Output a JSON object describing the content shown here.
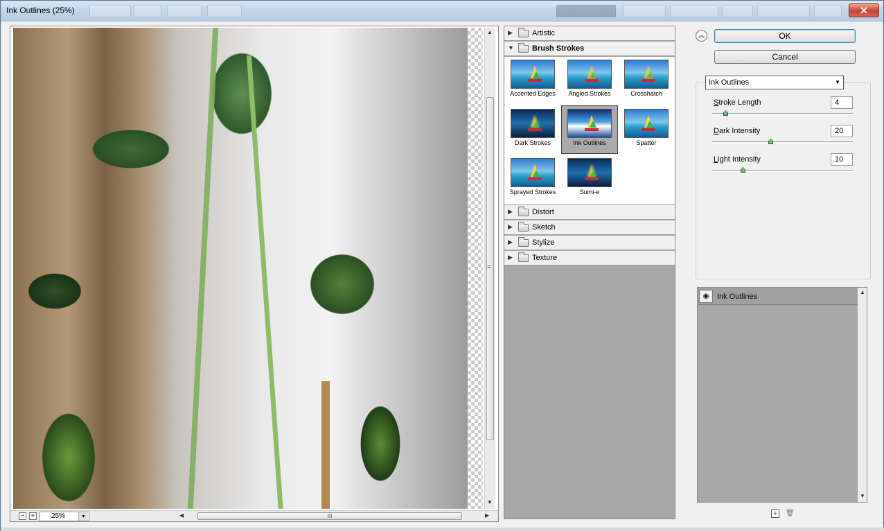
{
  "window": {
    "title": "Ink Outlines (25%)",
    "close_glyph": "✕"
  },
  "preview": {
    "zoom_value": "25%",
    "zoom_out": "−",
    "zoom_in": "+",
    "zoom_drop": "▾",
    "grip_h": "III",
    "grip_v": "≡",
    "arrow_up": "▲",
    "arrow_down": "▼",
    "arrow_left": "◀",
    "arrow_right": "▶"
  },
  "gallery": {
    "categories_top": [
      {
        "label": "Artistic",
        "expanded": false,
        "tri": "▶"
      },
      {
        "label": "Brush Strokes",
        "expanded": true,
        "tri": "▼"
      }
    ],
    "thumbnails": [
      {
        "label": "Accented Edges",
        "selected": false
      },
      {
        "label": "Angled Strokes",
        "selected": false
      },
      {
        "label": "Crosshatch",
        "selected": false
      },
      {
        "label": "Dark Strokes",
        "selected": false
      },
      {
        "label": "Ink Outlines",
        "selected": true
      },
      {
        "label": "Spatter",
        "selected": false
      },
      {
        "label": "Sprayed Strokes",
        "selected": false
      },
      {
        "label": "Sumi-e",
        "selected": false
      }
    ],
    "categories_bottom": [
      {
        "label": "Distort",
        "tri": "▶"
      },
      {
        "label": "Sketch",
        "tri": "▶"
      },
      {
        "label": "Stylize",
        "tri": "▶"
      },
      {
        "label": "Texture",
        "tri": "▶"
      }
    ]
  },
  "panel": {
    "collapse_glyph": "︽",
    "ok_label": "OK",
    "cancel_label": "Cancel",
    "filter_select": "Ink Outlines",
    "dropdown_glyph": "▼",
    "params": [
      {
        "label_first": "S",
        "label_rest": "troke Length",
        "value": "4",
        "level": 0.08
      },
      {
        "label_first": "D",
        "label_rest": "ark Intensity",
        "value": "20",
        "level": 0.4
      },
      {
        "label_first": "L",
        "label_rest": "ight Intensity",
        "value": "10",
        "level": 0.2
      }
    ],
    "layer_label": "Ink Outlines",
    "eye_glyph": "◉",
    "new_layer_glyph": "+",
    "trash_glyph": "🗑"
  },
  "colors": {
    "selected_thumb_bg": "#aaaaaa",
    "ok_border": "#3c7fb1",
    "slider_knob": "#6fb36f"
  }
}
